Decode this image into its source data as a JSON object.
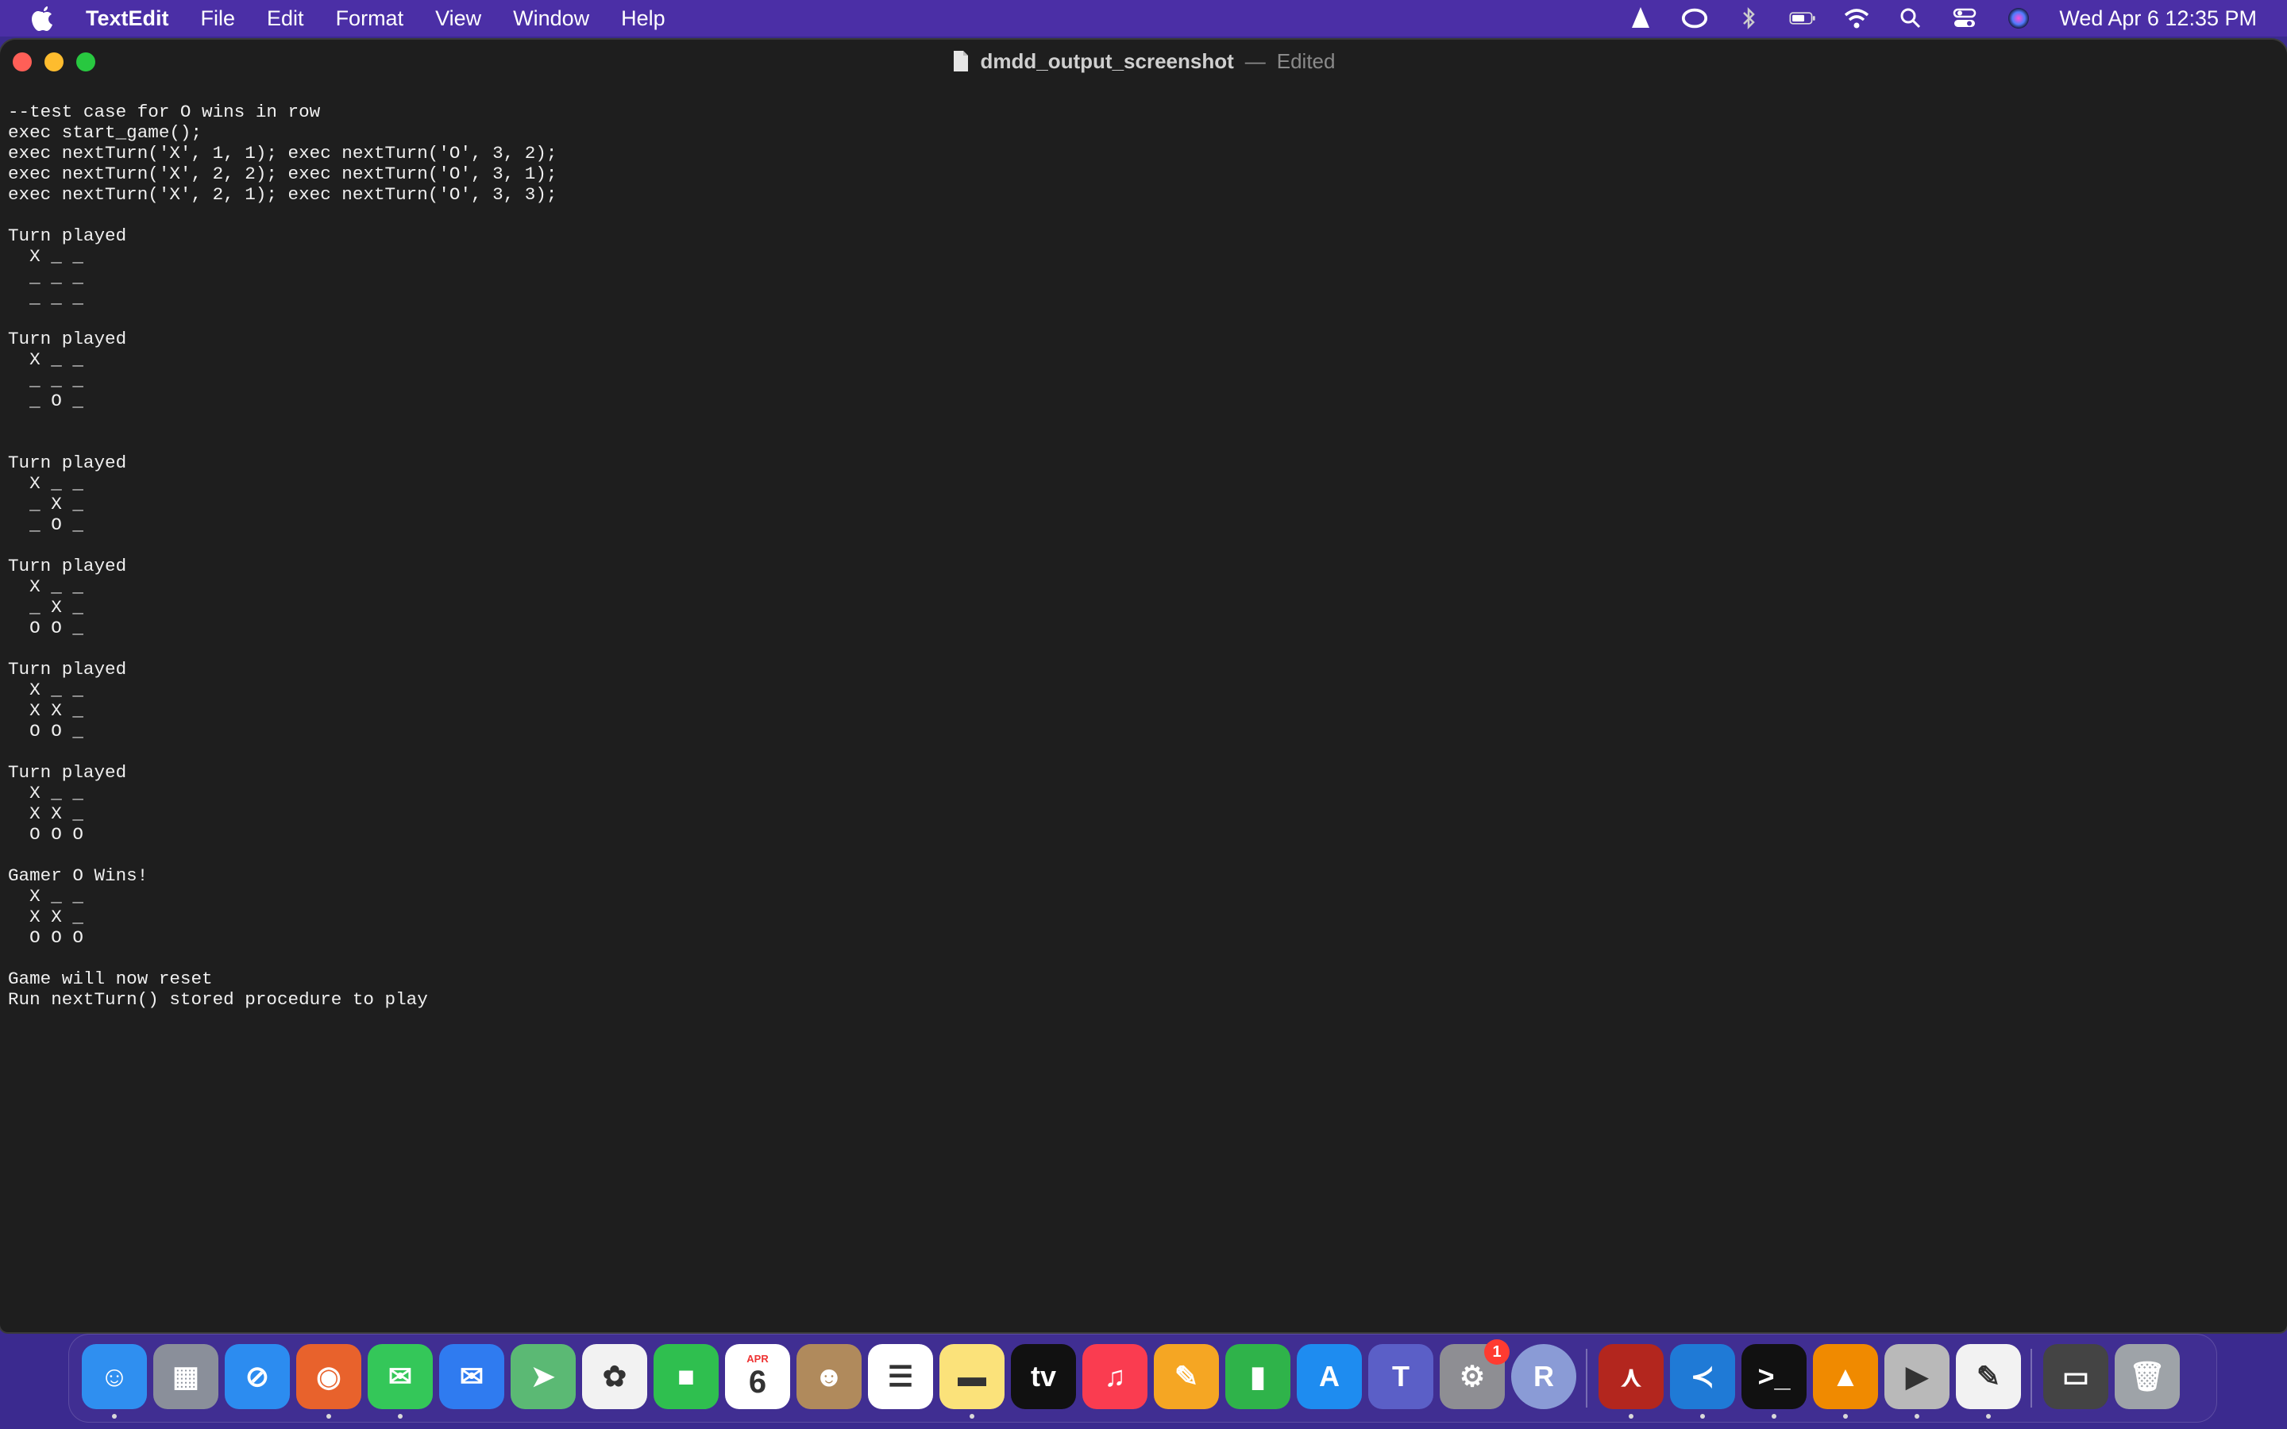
{
  "menubar": {
    "app_name": "TextEdit",
    "items": [
      "File",
      "Edit",
      "Format",
      "View",
      "Window",
      "Help"
    ],
    "clock": "Wed Apr 6  12:35 PM",
    "status_icons": [
      "vlc-icon",
      "creative-cloud-icon",
      "bluetooth-icon",
      "battery-icon",
      "wifi-icon",
      "search-icon",
      "control-center-icon",
      "siri-icon"
    ]
  },
  "window": {
    "filename": "dmdd_output_screenshot",
    "separator": "—",
    "state": "Edited"
  },
  "document": {
    "lines": [
      "--test case for O wins in row",
      "exec start_game();",
      "exec nextTurn('X', 1, 1); exec nextTurn('O', 3, 2);",
      "exec nextTurn('X', 2, 2); exec nextTurn('O', 3, 1);",
      "exec nextTurn('X', 2, 1); exec nextTurn('O', 3, 3);",
      "",
      "Turn played",
      "  X _ _",
      "  _ _ _",
      "  _ _ _",
      "",
      "Turn played",
      "  X _ _",
      "  _ _ _",
      "  _ O _",
      "",
      "",
      "Turn played",
      "  X _ _",
      "  _ X _",
      "  _ O _",
      "",
      "Turn played",
      "  X _ _",
      "  _ X _",
      "  O O _",
      "",
      "Turn played",
      "  X _ _",
      "  X X _",
      "  O O _",
      "",
      "Turn played",
      "  X _ _",
      "  X X _",
      "  O O O",
      "",
      "Gamer O Wins!",
      "  X _ _",
      "  X X _",
      "  O O O",
      "",
      "Game will now reset",
      "Run nextTurn() stored procedure to play"
    ]
  },
  "dock": {
    "apps": [
      {
        "name": "finder",
        "color": "#2f8ff0",
        "glyph": "☺",
        "running": true
      },
      {
        "name": "launchpad",
        "color": "#8a8f9a",
        "glyph": "▦",
        "running": false
      },
      {
        "name": "safari",
        "color": "#2c8cf0",
        "glyph": "⊘",
        "running": false
      },
      {
        "name": "firefox",
        "color": "#e8622c",
        "glyph": "◉",
        "running": true
      },
      {
        "name": "messages",
        "color": "#34c759",
        "glyph": "✉",
        "running": true
      },
      {
        "name": "mail",
        "color": "#2f7bf0",
        "glyph": "✉",
        "running": false
      },
      {
        "name": "maps",
        "color": "#5bb974",
        "glyph": "➤",
        "running": false
      },
      {
        "name": "photos",
        "color": "#f2f2f2",
        "glyph": "✿",
        "running": false
      },
      {
        "name": "facetime",
        "color": "#2fbf4f",
        "glyph": "■",
        "running": false
      },
      {
        "name": "calendar",
        "color": "#ffffff",
        "glyph": "6",
        "running": false,
        "label": "APR"
      },
      {
        "name": "contacts",
        "color": "#b08a5c",
        "glyph": "☻",
        "running": false
      },
      {
        "name": "reminders",
        "color": "#ffffff",
        "glyph": "☰",
        "running": false
      },
      {
        "name": "notes",
        "color": "#fbe27a",
        "glyph": "▬",
        "running": true
      },
      {
        "name": "apple-tv",
        "color": "#111111",
        "glyph": "tv",
        "running": false
      },
      {
        "name": "music",
        "color": "#fa3c50",
        "glyph": "♫",
        "running": false
      },
      {
        "name": "pages",
        "color": "#f5a623",
        "glyph": "✎",
        "running": false
      },
      {
        "name": "numbers",
        "color": "#2fb34a",
        "glyph": "▮",
        "running": false
      },
      {
        "name": "app-store",
        "color": "#1e8cf0",
        "glyph": "A",
        "running": false
      },
      {
        "name": "teams",
        "color": "#5b5fc7",
        "glyph": "T",
        "running": false
      },
      {
        "name": "system-preferences",
        "color": "#8e8e93",
        "glyph": "⚙",
        "running": false,
        "badge": "1"
      },
      {
        "name": "r-app",
        "color": "#8a9bd6",
        "glyph": "R",
        "running": false
      },
      {
        "name": "acrobat",
        "color": "#b3261e",
        "glyph": "⋏",
        "running": true
      },
      {
        "name": "vscode",
        "color": "#1f7ad6",
        "glyph": "≺",
        "running": true
      },
      {
        "name": "terminal",
        "color": "#111111",
        "glyph": ">_",
        "running": true
      },
      {
        "name": "vlc",
        "color": "#f08a00",
        "glyph": "▲",
        "running": true
      },
      {
        "name": "sequel-app",
        "color": "#b9b9b9",
        "glyph": "▶",
        "running": true
      },
      {
        "name": "textedit",
        "color": "#f2f2f2",
        "glyph": "✎",
        "running": true
      },
      {
        "name": "recent-window",
        "color": "#444444",
        "glyph": "▭",
        "running": false
      },
      {
        "name": "trash",
        "color": "#9ea3a8",
        "glyph": "🗑",
        "running": false
      }
    ]
  }
}
